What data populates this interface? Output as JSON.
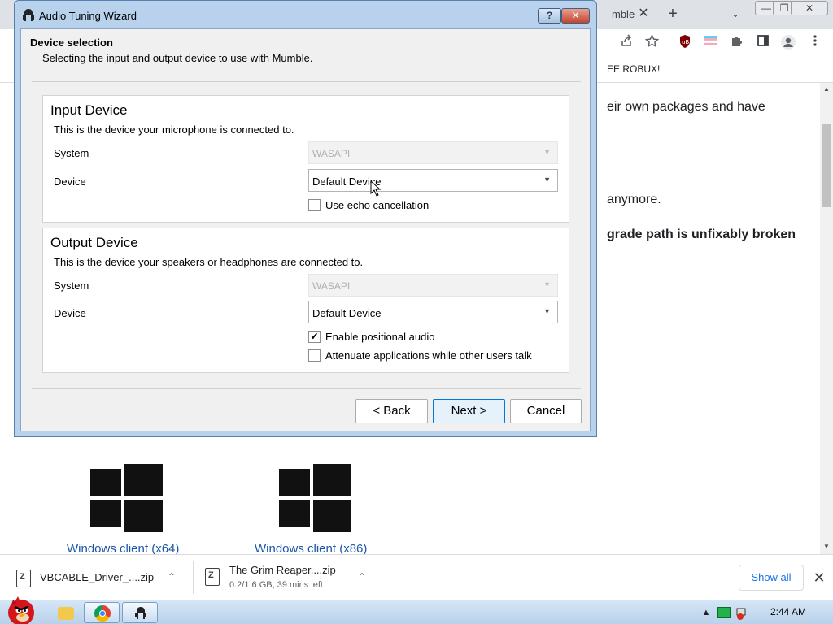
{
  "browser": {
    "tab_title": "mble",
    "tab_close": "✕",
    "new_tab": "+",
    "tab_search": "⌄",
    "window_controls": [
      "—",
      "❐",
      "✕"
    ],
    "bookmark_label": "EE ROBUX!",
    "page_lines": [
      "eir own packages and have",
      "anymore.",
      "grade path is unfixably broken",
      "."
    ],
    "downloads_links": [
      "Windows client (x64)",
      "Windows client (x86)"
    ]
  },
  "download_shelf": {
    "items": [
      {
        "name": "VBCABLE_Driver_....zip",
        "status": ""
      },
      {
        "name": "The Grim Reaper....zip",
        "status": "0.2/1.6 GB, 39 mins left"
      }
    ],
    "chevron": "⌃",
    "show_all": "Show all",
    "close": "✕"
  },
  "taskbar": {
    "clock": "2:44 AM"
  },
  "dialog": {
    "title": "Audio Tuning Wizard",
    "help_glyph": "?",
    "close_glyph": "✕",
    "page_heading": "Device selection",
    "page_subtitle": "Selecting the input and output device to use with Mumble.",
    "input": {
      "title": "Input Device",
      "description": "This is the device your microphone is connected to.",
      "system_label": "System",
      "system_value": "WASAPI",
      "device_label": "Device",
      "device_value": "Default Device",
      "echo_label": "Use echo cancellation",
      "echo_checked": false
    },
    "output": {
      "title": "Output Device",
      "description": "This is the device your speakers or headphones are connected to.",
      "system_label": "System",
      "system_value": "WASAPI",
      "device_label": "Device",
      "device_value": "Default Device",
      "positional_label": "Enable positional audio",
      "positional_checked": true,
      "attenuate_label": "Attenuate applications while other users talk",
      "attenuate_checked": false
    },
    "buttons": {
      "back": "< Back",
      "next": "Next >",
      "cancel": "Cancel"
    },
    "check_mark": "✔",
    "combo_arrow": "▼"
  },
  "icons": {
    "share": "share-icon",
    "star": "star-icon",
    "extensions": "puzzle-icon",
    "sidepanel": "side-panel-icon",
    "profile": "profile-icon",
    "menu": "kebab-menu-icon"
  }
}
